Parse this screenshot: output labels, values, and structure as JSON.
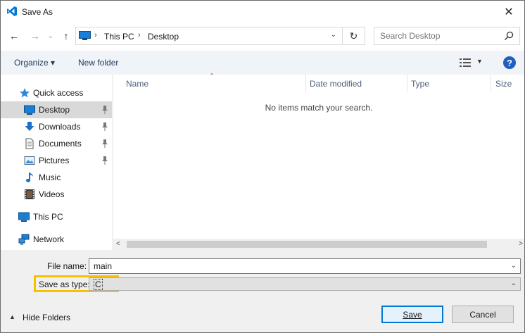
{
  "window": {
    "title": "Save As",
    "close_glyph": "✕"
  },
  "nav": {
    "back_glyph": "←",
    "forward_glyph": "→",
    "recent_glyph": "⌄",
    "up_glyph": "↑",
    "breadcrumb": [
      "This PC",
      "Desktop"
    ],
    "crumb_sep": "›",
    "dropdown_glyph": "⌄",
    "refresh_glyph": "↻",
    "search_placeholder": "Search Desktop"
  },
  "toolbar": {
    "organize": "Organize ▾",
    "new_folder": "New folder",
    "view_drop": "▼",
    "help": "?"
  },
  "sidebar": {
    "items": [
      {
        "label": "Quick access",
        "icon": "star-icon"
      },
      {
        "label": "Desktop",
        "icon": "desktop-icon",
        "pinned": true,
        "selected": true
      },
      {
        "label": "Downloads",
        "icon": "download-icon",
        "pinned": true
      },
      {
        "label": "Documents",
        "icon": "document-icon",
        "pinned": true
      },
      {
        "label": "Pictures",
        "icon": "picture-icon",
        "pinned": true
      },
      {
        "label": "Music",
        "icon": "music-icon"
      },
      {
        "label": "Videos",
        "icon": "video-icon"
      },
      {
        "label": "This PC",
        "icon": "computer-icon"
      },
      {
        "label": "Network",
        "icon": "network-icon"
      }
    ]
  },
  "files": {
    "sort_arrow": "^",
    "columns": [
      "Name",
      "Date modified",
      "Type",
      "Size"
    ],
    "empty_message": "No items match your search.",
    "scroll_left": "<",
    "scroll_right": ">"
  },
  "form": {
    "file_name_label": "File name:",
    "file_name_value": "main",
    "save_type_label": "Save as type:",
    "save_type_value": "C",
    "dropdown_glyph": "⌄"
  },
  "footer": {
    "hide_folders_glyph": "▲",
    "hide_folders": "Hide Folders",
    "save": "Save",
    "cancel": "Cancel"
  },
  "colors": {
    "accent": "#0078d7",
    "highlight": "#f6c200",
    "toolbar_bg": "#f0f4f9",
    "bottom_bg": "#f0f0f0"
  }
}
